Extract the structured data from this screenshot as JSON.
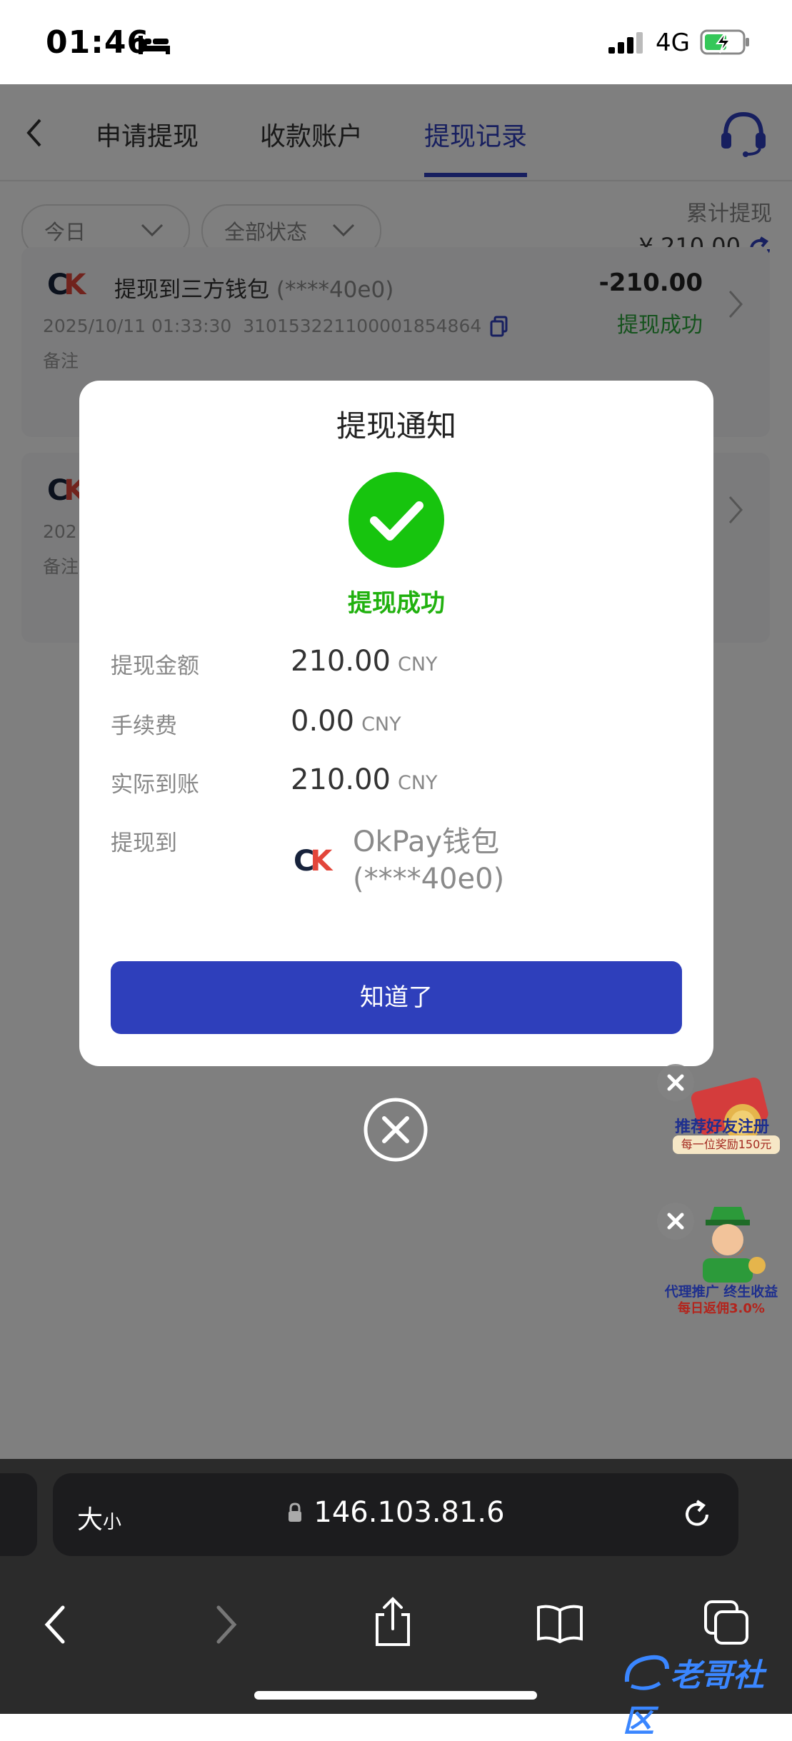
{
  "status_bar": {
    "time": "01:46",
    "network": "4G"
  },
  "nav": {
    "tabs": [
      "申请提现",
      "收款账户",
      "提现记录"
    ],
    "active_tab_index": 2
  },
  "filters": {
    "date": "今日",
    "status": "全部状态"
  },
  "summary": {
    "label": "累计提现",
    "value": "¥ 210.00"
  },
  "records": [
    {
      "title": "提现到三方钱包",
      "masked_account": "(****40e0)",
      "datetime": "2025/10/11 01:33:30",
      "order_id": "310153221100001854864",
      "note_label": "备注",
      "amount": "-210.00",
      "status": "提现成功"
    },
    {
      "datetime_partial": "202",
      "note_label": "备注"
    }
  ],
  "modal": {
    "title": "提现通知",
    "status_text": "提现成功",
    "rows": [
      {
        "label": "提现金额",
        "value": "210.00",
        "unit": "CNY"
      },
      {
        "label": "手续费",
        "value": "0.00",
        "unit": "CNY"
      },
      {
        "label": "实际到账",
        "value": "210.00",
        "unit": "CNY"
      }
    ],
    "dest_label": "提现到",
    "dest_name_line1": "OkPay钱包",
    "dest_name_line2": "(****40e0)",
    "confirm_button": "知道了"
  },
  "promos": [
    {
      "title": "推荐好友注册",
      "sub": "每一位奖励150元"
    },
    {
      "title": "代理推广 终生收益",
      "sub": "每日返佣3.0%"
    }
  ],
  "browser": {
    "text_size_big": "大",
    "text_size_small": "小",
    "url": "146.103.81.6"
  },
  "watermark": "老哥社区",
  "colors": {
    "accent": "#2e3fbb",
    "success": "#17c40e",
    "success_text": "#21b10f"
  }
}
